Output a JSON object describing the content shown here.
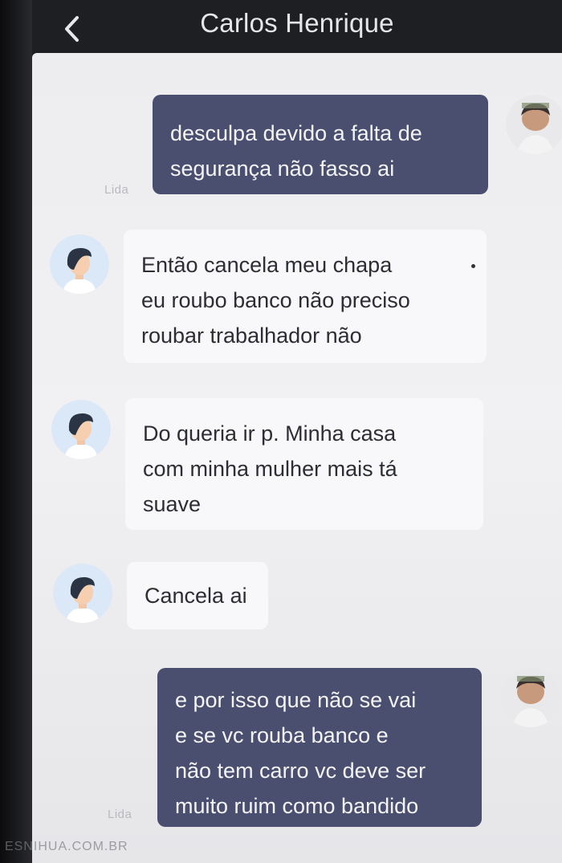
{
  "header": {
    "title": "Carlos Henrique",
    "back_icon": "chevron-left-icon"
  },
  "messages": [
    {
      "direction": "outgoing",
      "lines": [
        "desculpa devido a falta de",
        "segurança não fasso ai"
      ],
      "read_label": "Lida"
    },
    {
      "direction": "incoming",
      "lines": [
        "Então cancela meu chapa",
        "eu roubo banco não preciso",
        "roubar trabalhador não"
      ]
    },
    {
      "direction": "incoming",
      "lines": [
        "Do queria ir p. Minha casa",
        "com minha mulher mais tá",
        "suave"
      ]
    },
    {
      "direction": "incoming",
      "lines": [
        "Cancela ai"
      ]
    },
    {
      "direction": "outgoing",
      "lines": [
        "e por isso que não se vai",
        "e se vc rouba banco e",
        "não tem carro vc deve ser",
        "muito ruim como bandido"
      ],
      "read_label": "Lida"
    }
  ],
  "watermark": "ESNIHUA.COM.BR",
  "colors": {
    "header_bg": "#1d1f23",
    "chat_bg": "#eeeef1",
    "outgoing_bubble": "#4a4f70",
    "incoming_bubble": "#f8f8fa",
    "incoming_avatar_bg": "#dbe8f7"
  }
}
